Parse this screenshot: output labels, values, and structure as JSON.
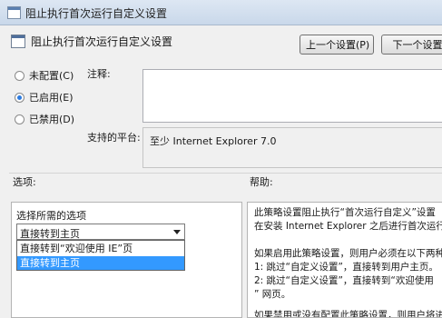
{
  "window": {
    "title": "阻止执行首次运行自定义设置"
  },
  "header": {
    "title": "阻止执行首次运行自定义设置",
    "prev_button": "上一个设置(P)",
    "next_button": "下一个设置"
  },
  "state": {
    "options": [
      {
        "label": "未配置(C)",
        "checked": false
      },
      {
        "label": "已启用(E)",
        "checked": true
      },
      {
        "label": "已禁用(D)",
        "checked": false
      }
    ]
  },
  "comment": {
    "label": "注释:",
    "value": ""
  },
  "platform": {
    "label": "支持的平台:",
    "value": "至少 Internet Explorer 7.0"
  },
  "options_section": {
    "label": "选项:",
    "select_label": "选择所需的选项",
    "selected_value": "直接转到主页",
    "dropdown_items": [
      {
        "label": "直接转到“欢迎使用 IE”页",
        "highlighted": false
      },
      {
        "label": "直接转到主页",
        "highlighted": true
      }
    ]
  },
  "help_section": {
    "label": "帮助:",
    "lines": [
      "此策略设置阻止执行“首次运行自定义”设置",
      "在安装 Internet Explorer 之后进行首次运行",
      "",
      "如果启用此策略设置，则用户必须在以下两种",
      "1: 跳过“自定义设置”，直接转到用户主页。",
      "2: 跳过“自定义设置”，直接转到“欢迎使用",
      "” 网页。",
      "",
      "如果禁用或没有配置此策略设置，则用户将进"
    ]
  }
}
